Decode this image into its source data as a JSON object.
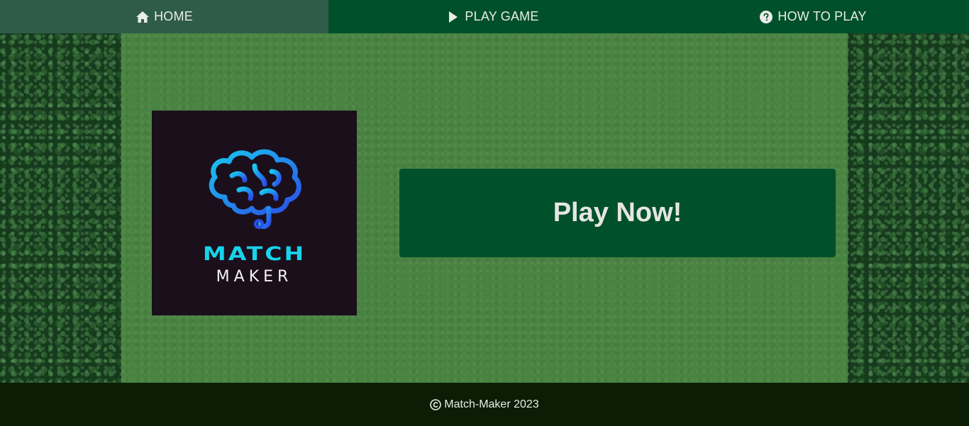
{
  "nav": {
    "items": [
      {
        "label": "HOME",
        "icon": "home-icon"
      },
      {
        "label": "PLAY GAME",
        "icon": "play-icon"
      },
      {
        "label": "HOW TO PLAY",
        "icon": "question-circle-icon"
      }
    ],
    "active_index": 0
  },
  "logo": {
    "icon": "brain-icon",
    "title": "MATCH",
    "subtitle": "MAKER"
  },
  "main": {
    "play_button_label": "Play Now!"
  },
  "footer": {
    "icon": "copyright-icon",
    "text": "Match-Maker 2023"
  },
  "colors": {
    "nav_bg": "#00502b",
    "nav_active_bg": "#2f5c49",
    "panel_bg": "#4a8442",
    "button_bg": "#00502b",
    "footer_bg": "#0b1d04",
    "logo_bg": "#1b0f1c",
    "logo_title": "#17d3ea"
  }
}
